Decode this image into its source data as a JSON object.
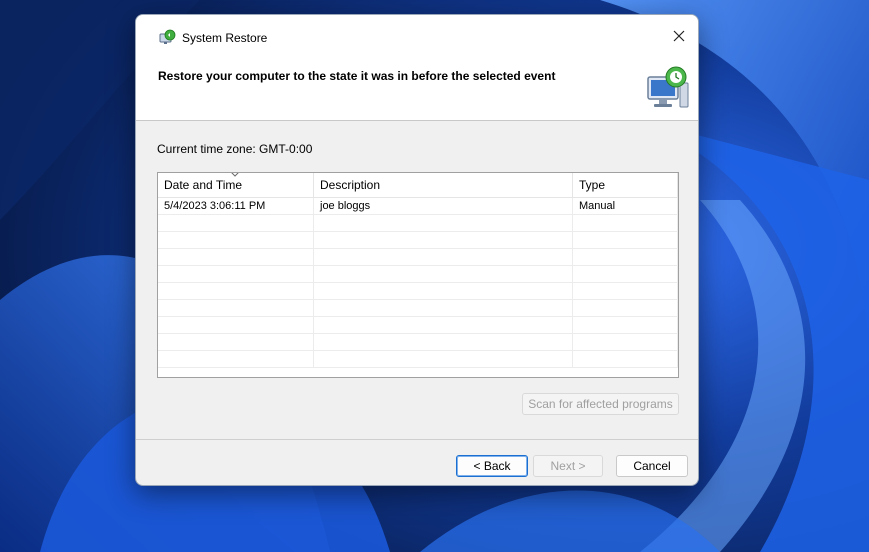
{
  "dialog": {
    "title": "System Restore",
    "heading": "Restore your computer to the state it was in before the selected event",
    "timezone": "Current time zone: GMT-0:00"
  },
  "table": {
    "columns": [
      "Date and Time",
      "Description",
      "Type"
    ],
    "rows": [
      {
        "date": "5/4/2023 3:06:11 PM",
        "description": "joe bloggs",
        "type": "Manual"
      }
    ]
  },
  "buttons": {
    "scan": "Scan for affected programs",
    "back": "< Back",
    "next": "Next >",
    "cancel": "Cancel"
  },
  "icons": {
    "title": "system-restore-icon",
    "close": "close-icon",
    "header": "restore-monitor-icon",
    "sort": "sort-descending-icon"
  },
  "colors": {
    "accent": "#1a6fd1",
    "dialog_bg": "#f0f0f0",
    "header_bg": "#ffffff"
  }
}
